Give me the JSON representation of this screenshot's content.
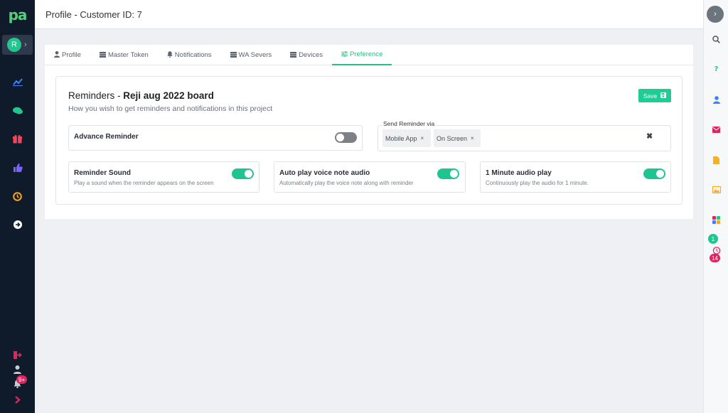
{
  "app": {
    "logo_text": "pa"
  },
  "header": {
    "title": "Profile - Customer ID: 7"
  },
  "user": {
    "avatar_initial": "R"
  },
  "sidebar": {
    "icons": [
      "chart-icon",
      "chat-icon",
      "gift-icon",
      "thumbs-up-icon",
      "history-icon",
      "arrow-circle-right-icon"
    ],
    "bottom_icons": [
      "logout-icon",
      "user-icon",
      "bell-icon",
      "chevron-right-icon"
    ],
    "bell_badge": "9+"
  },
  "tabs": [
    {
      "label": "Profile",
      "icon": "user-icon"
    },
    {
      "label": "Master Token",
      "icon": "table-icon"
    },
    {
      "label": "Notifications",
      "icon": "bell-icon"
    },
    {
      "label": "WA Severs",
      "icon": "table-icon"
    },
    {
      "label": "Devices",
      "icon": "table-icon"
    },
    {
      "label": "Preference",
      "icon": "sliders-icon",
      "active": true
    }
  ],
  "reminders": {
    "title_prefix": "Reminders - ",
    "board_name": "Reji aug 2022 board",
    "subtitle": "How you wish to get reminders and notifications in this project",
    "save_label": "Save",
    "advance_reminder": {
      "label": "Advance Reminder",
      "enabled": false
    },
    "send_via": {
      "label": "Send Reminder via",
      "selected": [
        "Mobile App",
        "On Screen"
      ],
      "chip_remove": "×",
      "clear": "✖"
    },
    "options": [
      {
        "label": "Reminder Sound",
        "description": "Play a sound when the reminder appears on the screen",
        "enabled": true
      },
      {
        "label": "Auto play voice note audio",
        "description": "Automatically play the voice note along with reminder",
        "enabled": true
      },
      {
        "label": "1 Minute audio play",
        "description": "Continuously play the audio for 1 minute.",
        "enabled": true
      }
    ]
  },
  "right_rail": {
    "icons": [
      "search-icon",
      "help-icon",
      "contact-icon",
      "mail-icon",
      "file-icon",
      "image-icon",
      "apps-icon",
      "alarm-icon"
    ],
    "badge_top": "1",
    "badge_bottom": "14"
  },
  "colors": {
    "accent": "#1fc590",
    "sidebar_bg": "#0f1a2a",
    "danger": "#e0245e"
  }
}
